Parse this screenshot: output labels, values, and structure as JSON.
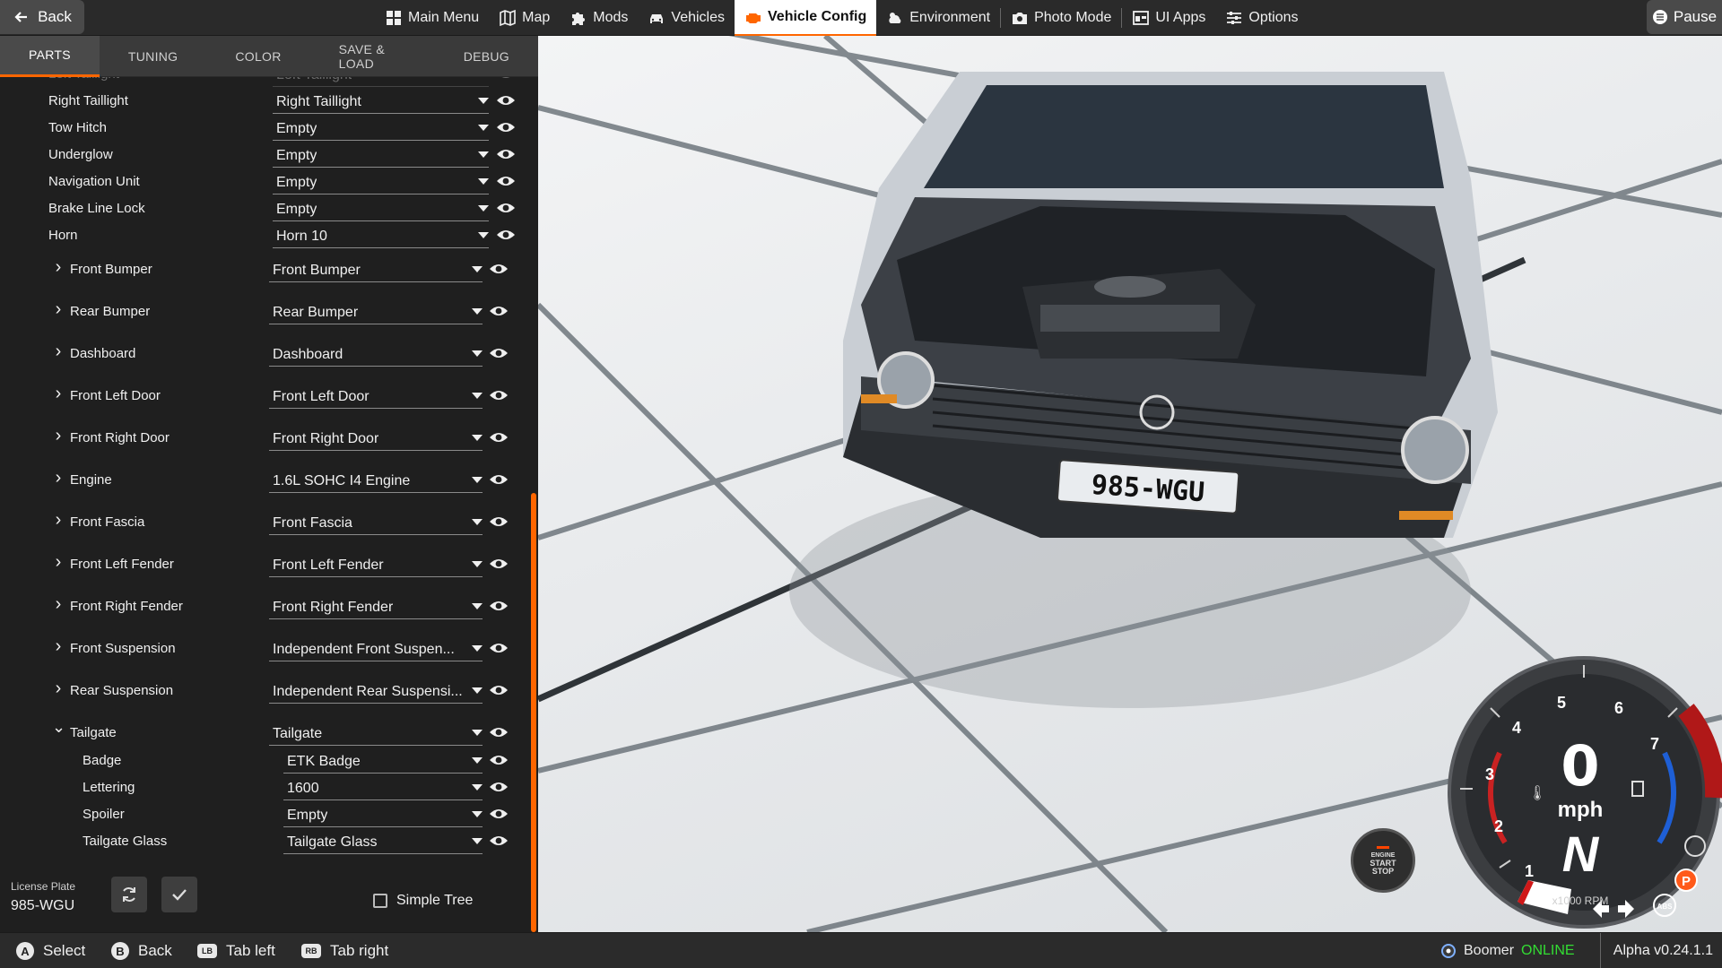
{
  "topbar": {
    "back_label": "Back",
    "pause_label": "Pause",
    "menu": [
      {
        "label": "Main Menu",
        "icon": "grid-icon"
      },
      {
        "label": "Map",
        "icon": "map-icon"
      },
      {
        "label": "Mods",
        "icon": "puzzle-icon"
      },
      {
        "label": "Vehicles",
        "icon": "car-icon"
      },
      {
        "label": "Vehicle Config",
        "icon": "engine-icon",
        "active": true
      },
      {
        "label": "Environment",
        "icon": "weather-icon"
      },
      {
        "label": "Photo Mode",
        "icon": "camera-icon"
      },
      {
        "label": "UI Apps",
        "icon": "apps-icon"
      },
      {
        "label": "Options",
        "icon": "sliders-icon"
      }
    ]
  },
  "tabs": [
    "PARTS",
    "TUNING",
    "COLOR",
    "SAVE & LOAD",
    "DEBUG"
  ],
  "active_tab": "PARTS",
  "parts": [
    {
      "label": "Left Taillight",
      "value": "Left Taillight",
      "level": 1,
      "partial": true
    },
    {
      "label": "Right Taillight",
      "value": "Right Taillight",
      "level": 1
    },
    {
      "label": "Tow Hitch",
      "value": "Empty",
      "level": 1
    },
    {
      "label": "Underglow",
      "value": "Empty",
      "level": 1
    },
    {
      "label": "Navigation Unit",
      "value": "Empty",
      "level": 1
    },
    {
      "label": "Brake Line Lock",
      "value": "Empty",
      "level": 1
    },
    {
      "label": "Horn",
      "value": "Horn 10",
      "level": 1
    },
    {
      "label": "Front Bumper",
      "value": "Front Bumper",
      "level": 0,
      "expandable": true
    },
    {
      "label": "Rear Bumper",
      "value": "Rear Bumper",
      "level": 0,
      "expandable": true
    },
    {
      "label": "Dashboard",
      "value": "Dashboard",
      "level": 0,
      "expandable": true
    },
    {
      "label": "Front Left Door",
      "value": "Front Left Door",
      "level": 0,
      "expandable": true
    },
    {
      "label": "Front Right Door",
      "value": "Front Right Door",
      "level": 0,
      "expandable": true
    },
    {
      "label": "Engine",
      "value": "1.6L SOHC I4 Engine",
      "level": 0,
      "expandable": true
    },
    {
      "label": "Front Fascia",
      "value": "Front Fascia",
      "level": 0,
      "expandable": true
    },
    {
      "label": "Front Left Fender",
      "value": "Front Left Fender",
      "level": 0,
      "expandable": true
    },
    {
      "label": "Front Right Fender",
      "value": "Front Right Fender",
      "level": 0,
      "expandable": true
    },
    {
      "label": "Front Suspension",
      "value": "Independent Front Suspen...",
      "level": 0,
      "expandable": true
    },
    {
      "label": "Rear Suspension",
      "value": "Independent Rear Suspensi...",
      "level": 0,
      "expandable": true
    },
    {
      "label": "Tailgate",
      "value": "Tailgate",
      "level": 0,
      "expandable": true,
      "expanded": true
    },
    {
      "label": "Badge",
      "value": "ETK Badge",
      "level": 2
    },
    {
      "label": "Lettering",
      "value": "1600",
      "level": 2
    },
    {
      "label": "Spoiler",
      "value": "Empty",
      "level": 2
    },
    {
      "label": "Tailgate Glass",
      "value": "Tailgate Glass",
      "level": 2
    }
  ],
  "license_plate": {
    "label": "License Plate",
    "value": "985-WGU"
  },
  "simple_tree_label": "Simple Tree",
  "bottombar": {
    "hints": [
      {
        "button": "A",
        "label": "Select"
      },
      {
        "button": "B",
        "label": "Back"
      },
      {
        "button": "LB",
        "label": "Tab left"
      },
      {
        "button": "RB",
        "label": "Tab right"
      }
    ],
    "username": "Boomer",
    "status": "ONLINE",
    "version": "Alpha v0.24.1.1"
  },
  "scene": {
    "plate_text": "985-WGU"
  },
  "hud": {
    "engine_button": [
      "ENGINE",
      "START",
      "STOP"
    ],
    "speed": "0",
    "unit": "mph",
    "gear": "N",
    "rpm_label": "x1000 RPM",
    "rpm_ticks": [
      "1",
      "2",
      "3",
      "4",
      "5",
      "6",
      "7"
    ],
    "parking_label": "P",
    "abs_label": "ABS"
  },
  "colors": {
    "accent": "#ff6600",
    "online": "#33dd33",
    "redline": "#b01818",
    "fuel": "#1e5fd6"
  }
}
